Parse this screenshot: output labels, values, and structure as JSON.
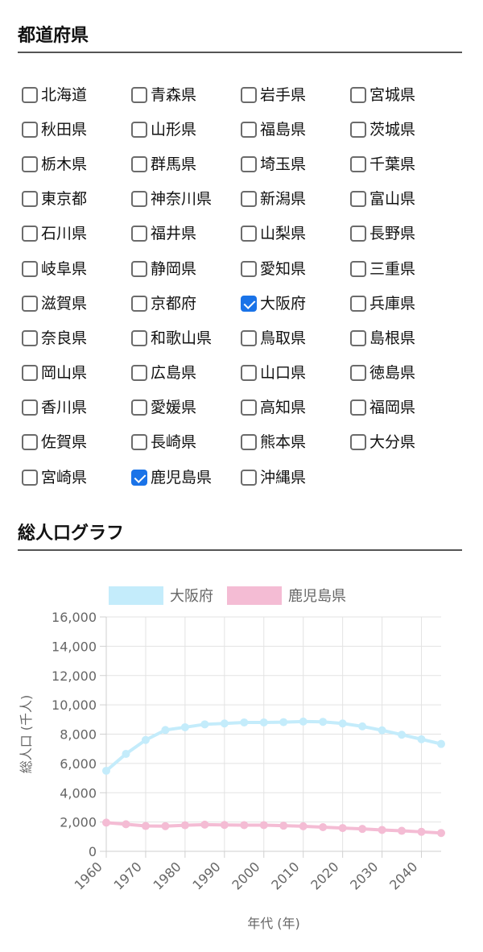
{
  "prefectures": {
    "title": "都道府県",
    "items": [
      {
        "label": "北海道",
        "checked": false
      },
      {
        "label": "青森県",
        "checked": false
      },
      {
        "label": "岩手県",
        "checked": false
      },
      {
        "label": "宮城県",
        "checked": false
      },
      {
        "label": "秋田県",
        "checked": false
      },
      {
        "label": "山形県",
        "checked": false
      },
      {
        "label": "福島県",
        "checked": false
      },
      {
        "label": "茨城県",
        "checked": false
      },
      {
        "label": "栃木県",
        "checked": false
      },
      {
        "label": "群馬県",
        "checked": false
      },
      {
        "label": "埼玉県",
        "checked": false
      },
      {
        "label": "千葉県",
        "checked": false
      },
      {
        "label": "東京都",
        "checked": false
      },
      {
        "label": "神奈川県",
        "checked": false
      },
      {
        "label": "新潟県",
        "checked": false
      },
      {
        "label": "富山県",
        "checked": false
      },
      {
        "label": "石川県",
        "checked": false
      },
      {
        "label": "福井県",
        "checked": false
      },
      {
        "label": "山梨県",
        "checked": false
      },
      {
        "label": "長野県",
        "checked": false
      },
      {
        "label": "岐阜県",
        "checked": false
      },
      {
        "label": "静岡県",
        "checked": false
      },
      {
        "label": "愛知県",
        "checked": false
      },
      {
        "label": "三重県",
        "checked": false
      },
      {
        "label": "滋賀県",
        "checked": false
      },
      {
        "label": "京都府",
        "checked": false
      },
      {
        "label": "大阪府",
        "checked": true
      },
      {
        "label": "兵庫県",
        "checked": false
      },
      {
        "label": "奈良県",
        "checked": false
      },
      {
        "label": "和歌山県",
        "checked": false
      },
      {
        "label": "鳥取県",
        "checked": false
      },
      {
        "label": "島根県",
        "checked": false
      },
      {
        "label": "岡山県",
        "checked": false
      },
      {
        "label": "広島県",
        "checked": false
      },
      {
        "label": "山口県",
        "checked": false
      },
      {
        "label": "徳島県",
        "checked": false
      },
      {
        "label": "香川県",
        "checked": false
      },
      {
        "label": "愛媛県",
        "checked": false
      },
      {
        "label": "高知県",
        "checked": false
      },
      {
        "label": "福岡県",
        "checked": false
      },
      {
        "label": "佐賀県",
        "checked": false
      },
      {
        "label": "長崎県",
        "checked": false
      },
      {
        "label": "熊本県",
        "checked": false
      },
      {
        "label": "大分県",
        "checked": false
      },
      {
        "label": "宮崎県",
        "checked": false
      },
      {
        "label": "鹿児島県",
        "checked": true
      },
      {
        "label": "沖縄県",
        "checked": false
      }
    ]
  },
  "graph": {
    "title": "総人口グラフ"
  },
  "chart_data": {
    "type": "line",
    "xlabel": "年代 (年)",
    "ylabel": "総人口 (千人)",
    "ylim": [
      0,
      16000
    ],
    "yticks": [
      0,
      2000,
      4000,
      6000,
      8000,
      10000,
      12000,
      14000,
      16000
    ],
    "ytick_labels": [
      "0",
      "2,000",
      "4,000",
      "6,000",
      "8,000",
      "10,000",
      "12,000",
      "14,000",
      "16,000"
    ],
    "xticks": [
      1960,
      1970,
      1980,
      1990,
      2000,
      2010,
      2020,
      2030,
      2040
    ],
    "grid": true,
    "legend_position": "top",
    "x": [
      1960,
      1965,
      1970,
      1975,
      1980,
      1985,
      1990,
      1995,
      2000,
      2005,
      2010,
      2015,
      2020,
      2025,
      2030,
      2035,
      2040,
      2045
    ],
    "series": [
      {
        "name": "大阪府",
        "color": "#c4ecfb",
        "values": [
          5500,
          6650,
          7600,
          8280,
          8470,
          8670,
          8730,
          8800,
          8800,
          8820,
          8860,
          8840,
          8730,
          8530,
          8260,
          7960,
          7650,
          7330
        ]
      },
      {
        "name": "鹿児島県",
        "color": "#f4bcd4",
        "values": [
          1960,
          1850,
          1730,
          1720,
          1780,
          1820,
          1800,
          1790,
          1790,
          1750,
          1710,
          1650,
          1590,
          1530,
          1460,
          1400,
          1330,
          1250
        ]
      }
    ]
  }
}
